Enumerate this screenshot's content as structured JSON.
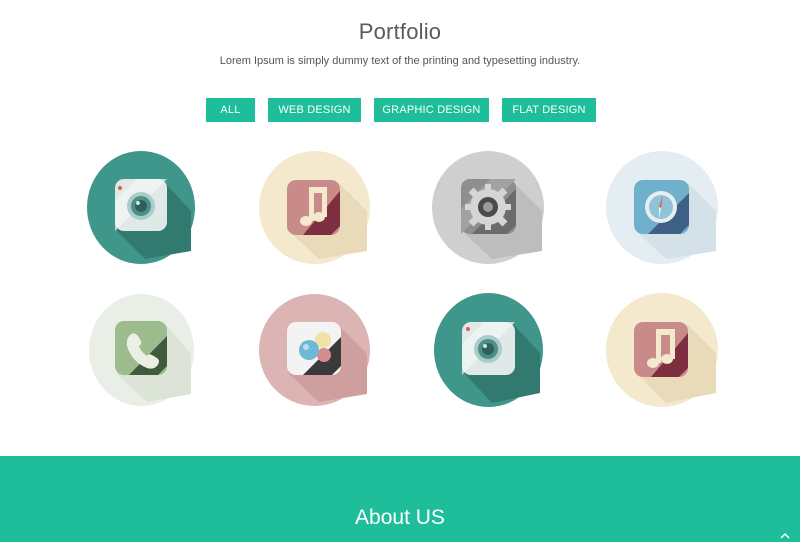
{
  "portfolio": {
    "title": "Portfolio",
    "subtitle": "Lorem Ipsum is simply dummy text of the printing and typesetting industry."
  },
  "filters": [
    {
      "label": "ALL"
    },
    {
      "label": "WEB DESIGN"
    },
    {
      "label": "GRAPHIC DESIGN"
    },
    {
      "label": "FLAT DESIGN"
    }
  ],
  "portfolio_items": [
    {
      "icon": "camera-app-icon",
      "circle_color": "#3f968a"
    },
    {
      "icon": "music-app-icon",
      "circle_color": "#f5e9cd"
    },
    {
      "icon": "settings-gear-app-icon",
      "circle_color": "#cfcfcf"
    },
    {
      "icon": "compass-app-icon",
      "circle_color": "#e3edf2"
    },
    {
      "icon": "phone-app-icon",
      "circle_color": "#e9efe6"
    },
    {
      "icon": "game-center-app-icon",
      "circle_color": "#ddb4b4"
    },
    {
      "icon": "camera-app-icon",
      "circle_color": "#3f968a"
    },
    {
      "icon": "music-app-icon",
      "circle_color": "#f5e9cd"
    }
  ],
  "about": {
    "title": "About US"
  },
  "colors": {
    "accent": "#1fbe9a"
  }
}
